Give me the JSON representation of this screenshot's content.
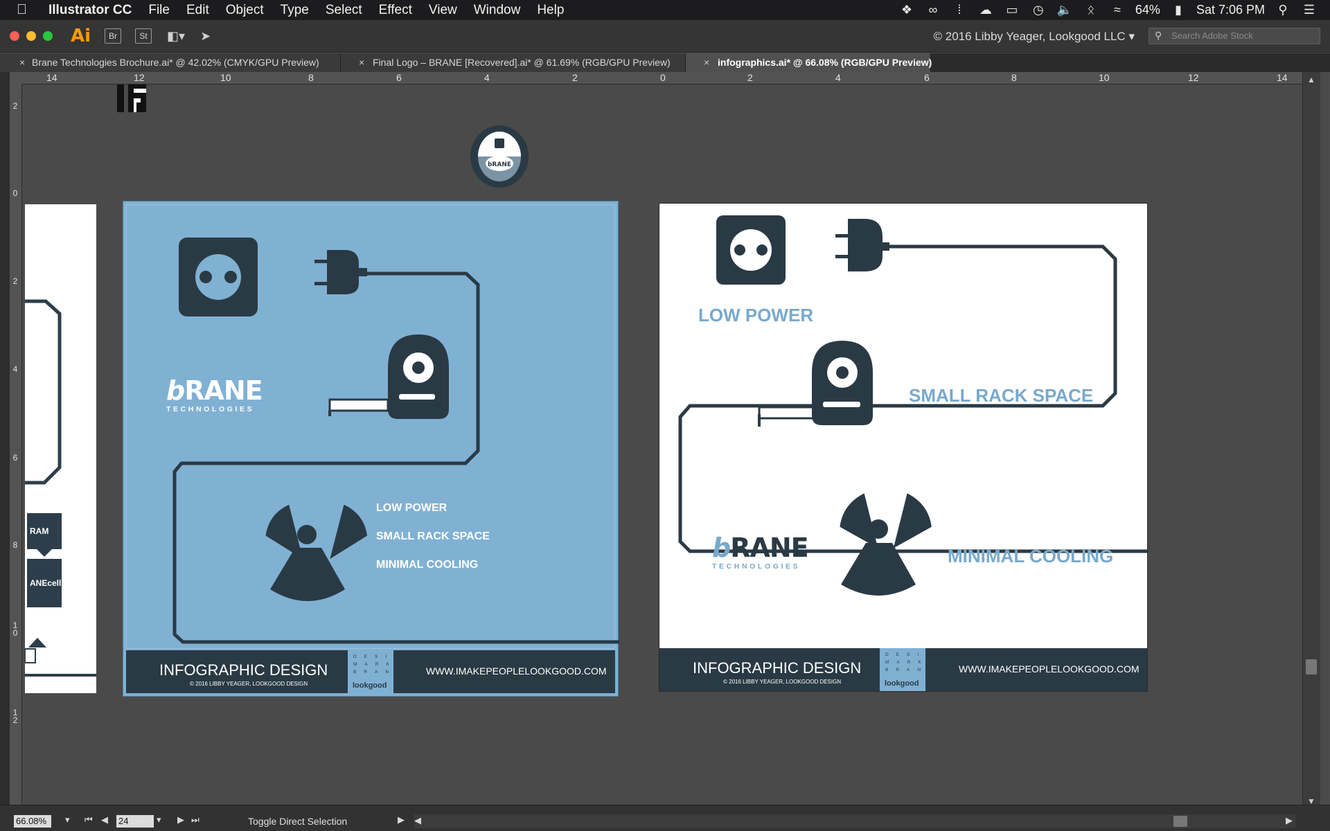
{
  "menubar": {
    "app_name": "Illustrator CC",
    "items": [
      "File",
      "Edit",
      "Object",
      "Type",
      "Select",
      "Effect",
      "View",
      "Window",
      "Help"
    ],
    "battery": "64%",
    "clock": "Sat 7:06 PM"
  },
  "appbar": {
    "app_logo": "Ai",
    "bridge_label": "Br",
    "stock_label": "St",
    "workspace_label": "© 2016 Libby Yeager, Lookgood LLC",
    "search_placeholder": "Search Adobe Stock"
  },
  "tabs": [
    {
      "label": "Brane Technologies Brochure.ai* @ 42.02% (CMYK/GPU Preview)",
      "active": false
    },
    {
      "label": "Final Logo – BRANE [Recovered].ai* @ 61.69% (RGB/GPU Preview)",
      "active": false
    },
    {
      "label": "infographics.ai* @ 66.08% (RGB/GPU Preview)",
      "active": true
    }
  ],
  "ruler": {
    "h_ticks": [
      "14",
      "12",
      "10",
      "8",
      "6",
      "4",
      "2",
      "0",
      "2",
      "4",
      "6",
      "8",
      "10",
      "12",
      "14"
    ],
    "v_ticks": [
      "2",
      "0",
      "2",
      "4",
      "6",
      "8",
      "1\n0",
      "1\n2"
    ]
  },
  "partial_board": {
    "tag1": "RAM",
    "tag2": "ANEcell"
  },
  "blue_board": {
    "brand_b": "b",
    "brand_word": "RANE",
    "brand_sub": "TECHNOLOGIES",
    "features": [
      "LOW POWER",
      "SMALL RACK SPACE",
      "MINIMAL COOLING"
    ],
    "footer_title": "INFOGRAPHIC DESIGN",
    "footer_copy": "© 2016 LIBBY YEAGER, LOOKGOOD DESIGN",
    "footer_letters": "DESIGN\nMARKET\nBRAND",
    "footer_logo": "lookgood",
    "footer_url": "WWW.IMAKEPEOPLELOOKGOOD.COM"
  },
  "white_board": {
    "brand_b": "b",
    "brand_word": "RANE",
    "brand_sub": "TECHNOLOGIES",
    "feature_low_power": "LOW POWER",
    "feature_rack": "SMALL RACK SPACE",
    "feature_cooling": "MINIMAL COOLING",
    "footer_title": "INFOGRAPHIC DESIGN",
    "footer_copy": "© 2016 LIBBY YEAGER, LOOKGOOD DESIGN",
    "footer_letters": "DESIGN\nMARKET\nBRAND",
    "footer_logo": "lookgood",
    "footer_url": "WWW.IMAKEPEOPLELOOKGOOD.COM"
  },
  "badge_label": "bRANE",
  "statusbar": {
    "zoom": "66.08%",
    "page": "24",
    "tool_hint": "Toggle Direct Selection"
  },
  "colors": {
    "accent_blue": "#80b1d3",
    "navy": "#2a3a45",
    "illustrator_orange": "#ff9a00"
  }
}
